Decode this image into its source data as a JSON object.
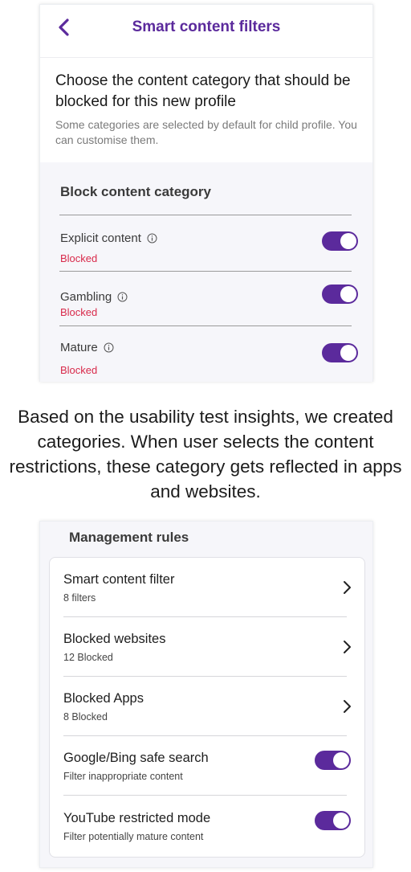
{
  "header": {
    "title": "Smart content filters",
    "back_icon": "chevron-left-icon"
  },
  "intro": {
    "title": "Choose the content category that should be blocked for this new profile",
    "subtitle": "Some categories are selected by default for child profile. You can customise them."
  },
  "block_section": {
    "title": "Block content category",
    "categories": [
      {
        "label": "Explicit content",
        "status": "Blocked",
        "enabled": true,
        "icon": "info-icon"
      },
      {
        "label": "Gambling",
        "status": "Blocked",
        "enabled": true,
        "icon": "info-icon"
      },
      {
        "label": "Mature",
        "status": "Blocked",
        "enabled": true,
        "icon": "info-icon"
      }
    ]
  },
  "caption": "Based on the usability test insights, we created categories. When user selects the content restrictions, these category gets reflected in apps and websites.",
  "management": {
    "title": "Management rules",
    "rules": [
      {
        "label": "Smart content filter",
        "sub": "8 filters",
        "control": "chevron-right-icon"
      },
      {
        "label": "Blocked websites",
        "sub": "12 Blocked",
        "control": "chevron-right-icon"
      },
      {
        "label": "Blocked Apps",
        "sub": "8 Blocked",
        "control": "chevron-right-icon"
      },
      {
        "label": "Google/Bing safe search",
        "sub": "Filter inappropriate content",
        "control": "toggle",
        "enabled": true
      },
      {
        "label": "YouTube restricted mode",
        "sub": "Filter potentially mature content",
        "control": "toggle",
        "enabled": true
      }
    ]
  },
  "colors": {
    "accent": "#5b2a9c",
    "blocked": "#d8294a",
    "section_bg": "#f6f6fa"
  }
}
